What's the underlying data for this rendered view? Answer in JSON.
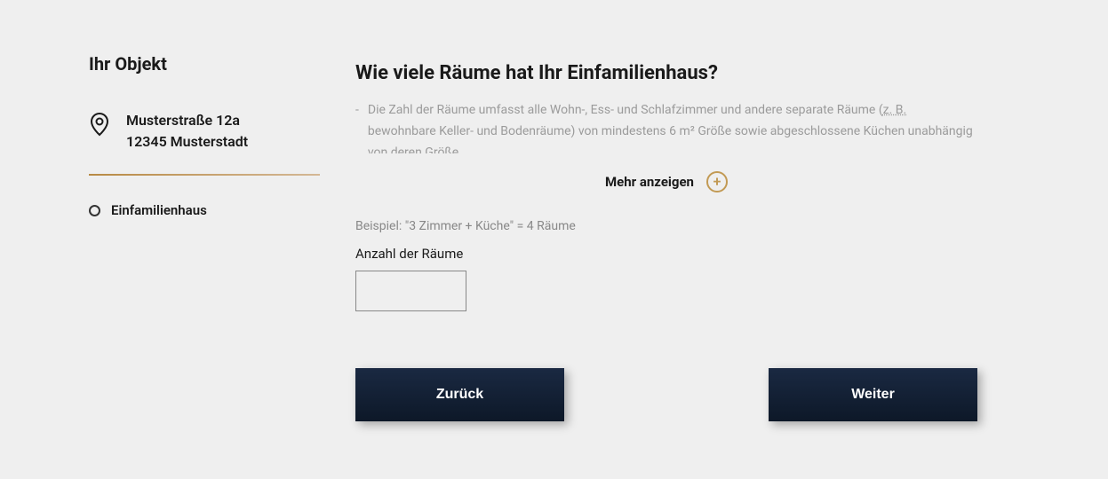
{
  "sidebar": {
    "title": "Ihr Objekt",
    "address": {
      "street": "Musterstraße 12a",
      "city": "12345 Musterstadt"
    },
    "property_type": "Einfamilienhaus"
  },
  "main": {
    "question": "Wie viele Räume hat Ihr Einfamilienhaus?",
    "description_prefix": "Die Zahl der Räume umfasst alle Wohn-, Ess- und Schlafzimmer und andere separate Räume (",
    "description_abbr": "z. B.",
    "description_suffix": " bewohnbare Keller- und Bodenräume) von mindestens 6 m² Größe sowie abgeschlossene Küchen unabhängig von deren Größe.",
    "show_more": "Mehr anzeigen",
    "example": "Beispiel: \"3 Zimmer + Küche\" = 4 Räume",
    "input_label": "Anzahl der Räume",
    "input_value": ""
  },
  "buttons": {
    "back": "Zurück",
    "next": "Weiter"
  }
}
